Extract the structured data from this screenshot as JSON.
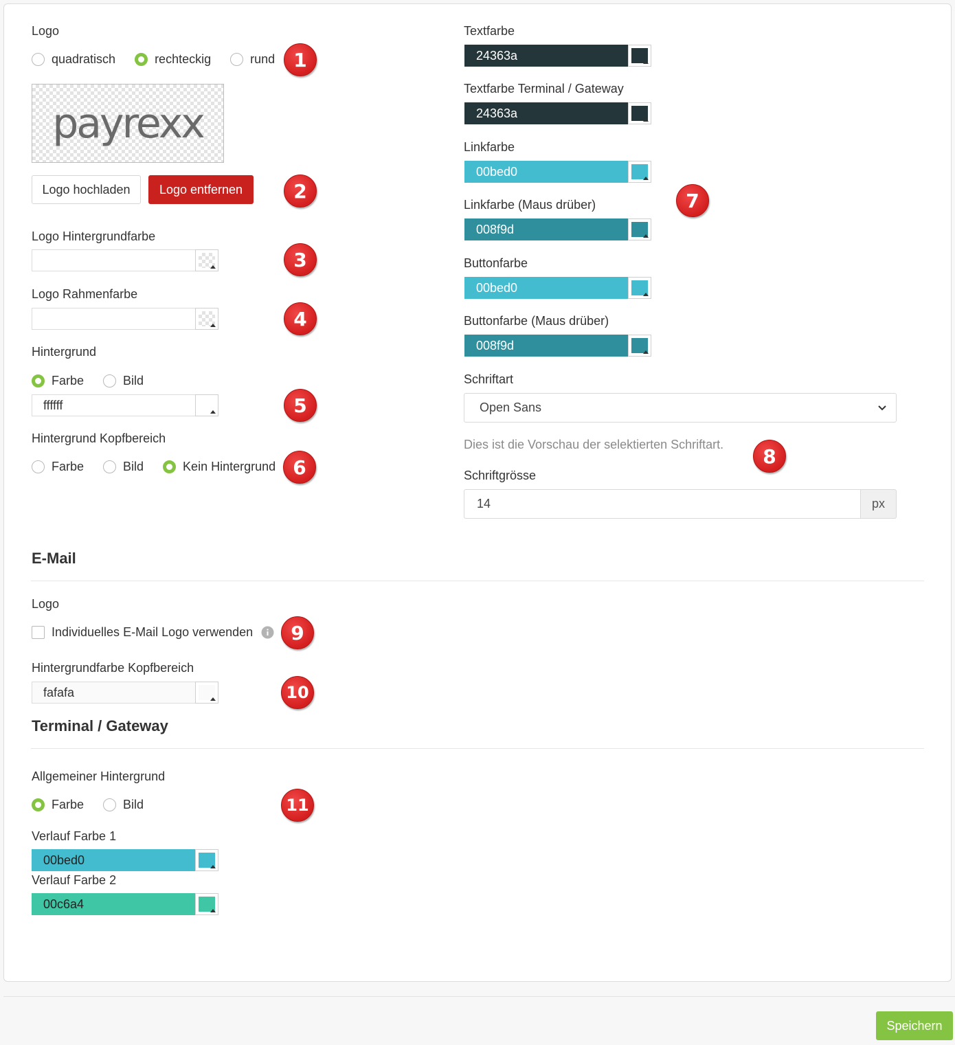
{
  "left": {
    "logo_label": "Logo",
    "logo_shape": [
      "quadratisch",
      "rechteckig",
      "rund"
    ],
    "logo_shape_selected": "rechteckig",
    "logo_preview_text": "payrexx",
    "upload_button": "Logo hochladen",
    "remove_button": "Logo entfernen",
    "logo_bg_label": "Logo Hintergrundfarbe",
    "logo_border_label": "Logo Rahmenfarbe",
    "bg_label": "Hintergrund",
    "bg_options": [
      "Farbe",
      "Bild"
    ],
    "bg_value": "ffffff",
    "header_bg_label": "Hintergrund Kopfbereich",
    "header_bg_options": [
      "Farbe",
      "Bild",
      "Kein Hintergrund"
    ]
  },
  "right": {
    "text_color": {
      "label": "Textfarbe",
      "value": "24363a",
      "color": "#24363a"
    },
    "text_color_terminal": {
      "label": "Textfarbe Terminal / Gateway",
      "value": "24363a",
      "color": "#24363a"
    },
    "link_color": {
      "label": "Linkfarbe",
      "value": "00bed0",
      "color": "#44bcd0"
    },
    "link_hover": {
      "label": "Linkfarbe (Maus drüber)",
      "value": "008f9d",
      "color": "#2f8f9c"
    },
    "button_color": {
      "label": "Buttonfarbe",
      "value": "00bed0",
      "color": "#44bcd0"
    },
    "button_hover": {
      "label": "Buttonfarbe (Maus drüber)",
      "value": "008f9d",
      "color": "#2f8f9c"
    },
    "font_label": "Schriftart",
    "font_value": "Open Sans",
    "font_preview": "Dies ist die Vorschau der selektierten Schriftart.",
    "font_size_label": "Schriftgrösse",
    "font_size_value": "14",
    "font_size_unit": "px"
  },
  "email": {
    "heading": "E-Mail",
    "logo_label": "Logo",
    "custom_logo": "Individuelles E-Mail Logo verwenden",
    "header_bg_label": "Hintergrundfarbe Kopfbereich",
    "header_bg_value": "fafafa"
  },
  "terminal": {
    "heading": "Terminal / Gateway",
    "bg_label": "Allgemeiner Hintergrund",
    "bg_options": [
      "Farbe",
      "Bild"
    ],
    "gradient1": {
      "label": "Verlauf Farbe 1",
      "value": "00bed0",
      "color": "#44bcd0"
    },
    "gradient2": {
      "label": "Verlauf Farbe 2",
      "value": "00c6a4",
      "color": "#3fc6a5"
    }
  },
  "badges": [
    "1",
    "2",
    "3",
    "4",
    "5",
    "6",
    "7",
    "8",
    "9",
    "10",
    "11"
  ],
  "footer": {
    "save": "Speichern"
  },
  "colors": {
    "accent_green": "#85c442",
    "danger": "#c9211e",
    "badge_red": "#d41f1f"
  }
}
